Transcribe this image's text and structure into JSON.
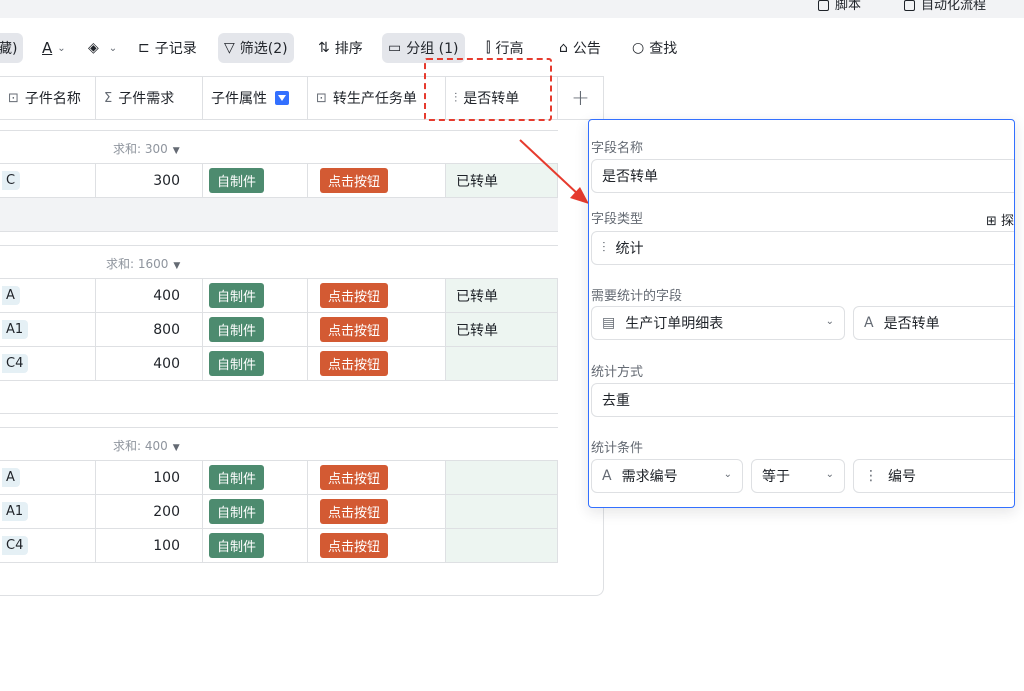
{
  "top_strip": {
    "item1": "脚本",
    "item2": "自动化流程"
  },
  "toolbar": {
    "hidden_label": "藏)",
    "text_color_glyph": "A",
    "subrecord": "子记录",
    "filter": "筛选(2)",
    "sort": "排序",
    "group": "分组 (1)",
    "row_height": "行高",
    "notice": "公告",
    "search": "查找"
  },
  "table": {
    "columns": [
      "子件名称",
      "子件需求",
      "子件属性",
      "转生产任务单",
      "是否转单"
    ],
    "add_column": "+",
    "groups": [
      {
        "sum": "求和: 300",
        "rows": [
          {
            "code": "C",
            "qty": "300",
            "attr": "自制件",
            "action": "点击按钮",
            "converted": "已转单"
          }
        ]
      },
      {
        "sum": "求和: 1600",
        "rows": [
          {
            "code": "A",
            "qty": "400",
            "attr": "自制件",
            "action": "点击按钮",
            "converted": "已转单"
          },
          {
            "code": "A1",
            "qty": "800",
            "attr": "自制件",
            "action": "点击按钮",
            "converted": "已转单"
          },
          {
            "code": "C4",
            "qty": "400",
            "attr": "自制件",
            "action": "点击按钮",
            "converted": ""
          }
        ]
      },
      {
        "sum": "求和: 400",
        "rows": [
          {
            "code": "A",
            "qty": "100",
            "attr": "自制件",
            "action": "点击按钮",
            "converted": ""
          },
          {
            "code": "A1",
            "qty": "200",
            "attr": "自制件",
            "action": "点击按钮",
            "converted": ""
          },
          {
            "code": "C4",
            "qty": "100",
            "attr": "自制件",
            "action": "点击按钮",
            "converted": ""
          }
        ]
      }
    ]
  },
  "panel": {
    "field_name_label": "字段名称",
    "field_name_value": "是否转单",
    "field_type_label": "字段类型",
    "explore": "探",
    "field_type_value": "统计",
    "stat_field_label": "需要统计的字段",
    "stat_table": "生产订单明细表",
    "stat_field": "是否转单",
    "method_label": "统计方式",
    "method_value": "去重",
    "condition_label": "统计条件",
    "cond_field": "需求编号",
    "cond_op": "等于",
    "cond_value": "编号"
  },
  "colors": {
    "accent": "#3370ff",
    "tag_green": "#4d8b6f",
    "tag_orange": "#d35a33",
    "highlight_red": "#e63b2e"
  }
}
